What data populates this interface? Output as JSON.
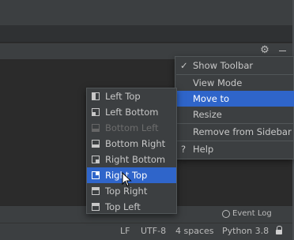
{
  "popup_menu": {
    "items": [
      {
        "label": "Show Toolbar",
        "checked": true
      },
      {
        "label": "View Mode",
        "has_submenu": true
      },
      {
        "label": "Move to",
        "has_submenu": true,
        "selected": true
      },
      {
        "label": "Resize",
        "has_submenu": true
      },
      {
        "label": "Remove from Sidebar"
      },
      {
        "label": "Help",
        "icon": "question-icon"
      }
    ],
    "check_glyph": "✓",
    "help_glyph": "?"
  },
  "submenu": {
    "items": [
      {
        "label": "Left Top",
        "icon": "left-top-icon"
      },
      {
        "label": "Left Bottom",
        "icon": "left-bottom-icon"
      },
      {
        "label": "Bottom Left",
        "icon": "bottom-left-icon",
        "disabled": true
      },
      {
        "label": "Bottom Right",
        "icon": "bottom-right-icon"
      },
      {
        "label": "Right Bottom",
        "icon": "right-bottom-icon"
      },
      {
        "label": "Right Top",
        "icon": "right-top-icon",
        "selected": true
      },
      {
        "label": "Top Right",
        "icon": "top-right-icon"
      },
      {
        "label": "Top Left",
        "icon": "top-left-icon"
      }
    ]
  },
  "tool_window": {
    "gear_glyph": "⚙"
  },
  "event_log": {
    "label": "Event Log"
  },
  "status_bar": {
    "line_separator": "LF",
    "encoding": "UTF-8",
    "indent": "4 spaces",
    "interpreter": "Python 3.8"
  },
  "colors": {
    "selection": "#2f65ca",
    "popup_bg": "#3c3f41",
    "editor_bg": "#2b2b2b"
  }
}
